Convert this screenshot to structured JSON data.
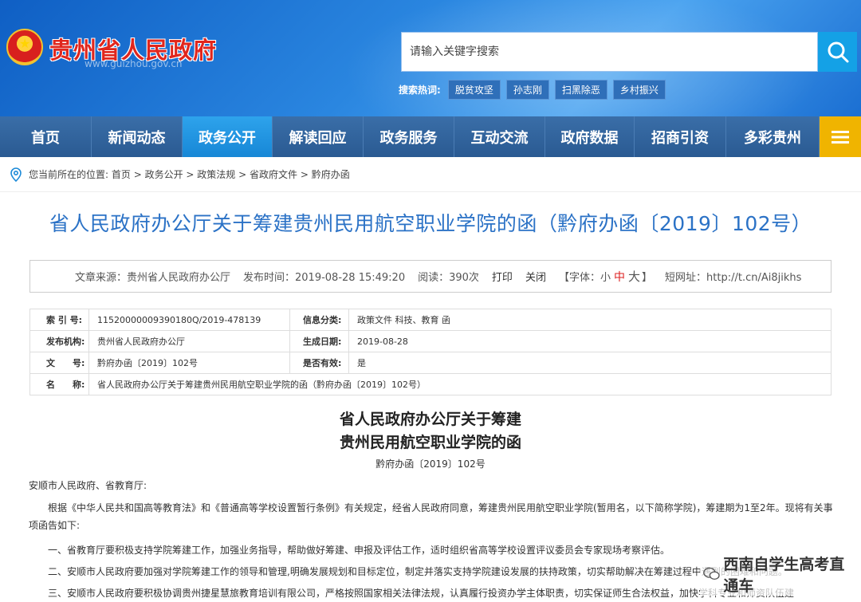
{
  "header": {
    "site_title": "贵州省人民政府",
    "site_url": "www.guizhou.gov.cn",
    "search_placeholder": "请输入关键字搜索",
    "hot_label": "搜索热词:",
    "hot_tags": [
      "脱贫攻坚",
      "孙志刚",
      "扫黑除恶",
      "乡村振兴"
    ]
  },
  "nav": {
    "items": [
      "首页",
      "新闻动态",
      "政务公开",
      "解读回应",
      "政务服务",
      "互动交流",
      "政府数据",
      "招商引资",
      "多彩贵州"
    ],
    "active_index": 2
  },
  "breadcrumb": {
    "prefix": "您当前所在的位置:",
    "path": [
      "首页",
      "政务公开",
      "政策法规",
      "省政府文件",
      "黔府办函"
    ]
  },
  "article": {
    "title": "省人民政府办公厅关于筹建贵州民用航空职业学院的函（黔府办函〔2019〕102号）",
    "meta": {
      "source": "文章来源：贵州省人民政府办公厅",
      "time": "发布时间：2019-08-28 15:49:20",
      "views": "阅读：390次",
      "print": "打印",
      "close": "关闭",
      "font_label": "【字体：",
      "font_small": "小",
      "font_mid": "中",
      "font_big": "大",
      "font_end": "】",
      "short_url": "短网址：http://t.cn/Ai8jikhs"
    },
    "info_rows": [
      {
        "k1": "索 引 号:",
        "v1": "11520000009390180Q/2019-478139",
        "k2": "信息分类:",
        "v2": "政策文件   科技、教育   函"
      },
      {
        "k1": "发布机构:",
        "v1": "贵州省人民政府办公厅",
        "k2": "生成日期:",
        "v2": "2019-08-28"
      },
      {
        "k1": "文　　号:",
        "v1": "黔府办函〔2019〕102号",
        "k2": "是否有效:",
        "v2": "是"
      }
    ],
    "name_key": "名　　称:",
    "name_value": "省人民政府办公厅关于筹建贵州民用航空职业学院的函（黔府办函〔2019〕102号）",
    "doc_title_1": "省人民政府办公厅关于筹建",
    "doc_title_2": "贵州民用航空职业学院的函",
    "doc_no": "黔府办函〔2019〕102号",
    "addressee": "安顺市人民政府、省教育厅:",
    "para1": "　　根据《中华人民共和国高等教育法》和《普通高等学校设置暂行条例》有关规定，经省人民政府同意，筹建贵州民用航空职业学院(暂用名，以下简称学院)，筹建期为1至2年。现将有关事项函告如下:",
    "item1": "　　一、省教育厅要积极支持学院筹建工作，加强业务指导，帮助做好筹建、申报及评估工作，适时组织省高等学校设置评议委员会专家现场考察评估。",
    "item2": "　　二、安顺市人民政府要加强对学院筹建工作的领导和管理,明确发展规划和目标定位，制定并落实支持学院建设发展的扶持政策，切实帮助解决在筹建过程中遇到的困难和问题。",
    "item3": "　　三、安顺市人民政府要积极协调贵州捷星慧旅教育培训有限公司，严格按照国家相关法律法规，认真履行投资办学主体职责，切实保证师生合法权益，加快学科专业和师资队伍建"
  },
  "watermark": "西南自学生高考直通车"
}
